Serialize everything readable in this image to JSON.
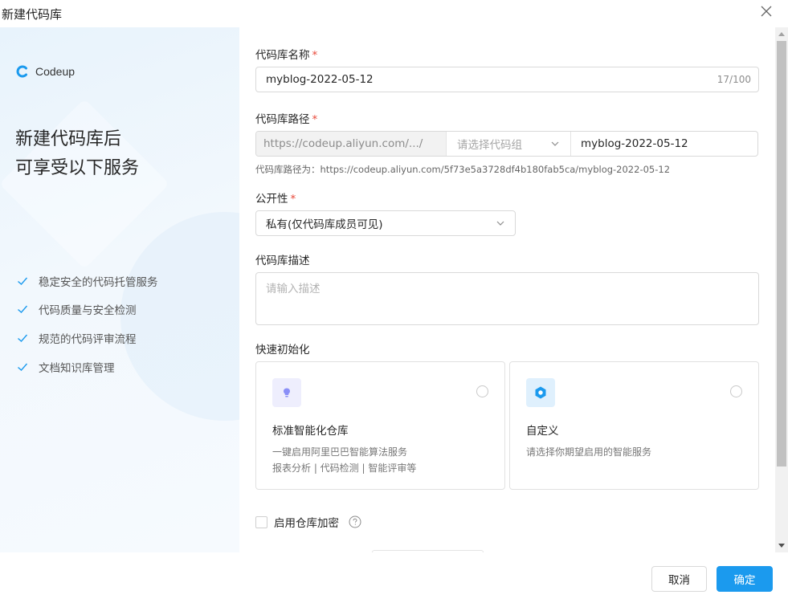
{
  "dialog": {
    "title": "新建代码库"
  },
  "left": {
    "logo_text": "Codeup",
    "heading_line1": "新建代码库后",
    "heading_line2": "可享受以下服务",
    "features": [
      "稳定安全的代码托管服务",
      "代码质量与安全检测",
      "规范的代码评审流程",
      "文档知识库管理"
    ]
  },
  "form": {
    "name": {
      "label": "代码库名称",
      "required": "*",
      "value": "myblog-2022-05-12",
      "counter": "17/100"
    },
    "path": {
      "label": "代码库路径",
      "required": "*",
      "prefix": "https://codeup.aliyun.com/.../",
      "group_placeholder": "请选择代码组",
      "value": "myblog-2022-05-12",
      "hint": "代码库路径为：https://codeup.aliyun.com/5f73e5a3728df4b180fab5ca/myblog-2022-05-12"
    },
    "visibility": {
      "label": "公开性",
      "required": "*",
      "value": "私有(仅代码库成员可见)"
    },
    "description": {
      "label": "代码库描述",
      "placeholder": "请输入描述"
    },
    "quick_init": {
      "label": "快速初始化",
      "cards": [
        {
          "title": "标准智能化仓库",
          "desc_line1": "一键启用阿里巴巴智能算法服务",
          "desc_line2": "报表分析 | 代码检测 | 智能评审等",
          "icon": "lightbulb-icon",
          "icon_bg": "#eeeefd",
          "icon_color": "#8a8ff7"
        },
        {
          "title": "自定义",
          "desc_line1": "请选择你期望启用的智能服务",
          "desc_line2": "",
          "icon": "hexagon-icon",
          "icon_bg": "#dff0fd",
          "icon_color": "#1b9aee"
        }
      ]
    },
    "encrypt": {
      "label": "启用仓库加密"
    }
  },
  "footer": {
    "cancel_label": "取消",
    "ok_label": "确定"
  },
  "colors": {
    "accent": "#1b9aee",
    "required": "#e84738"
  }
}
